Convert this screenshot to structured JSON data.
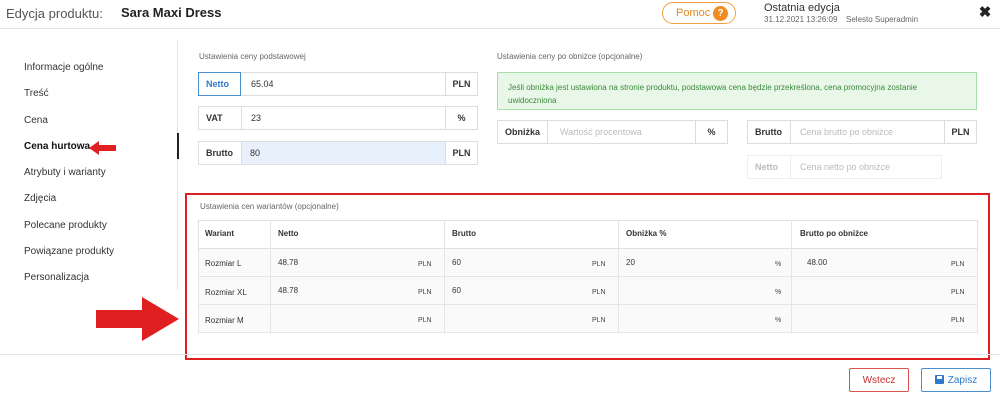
{
  "header": {
    "title_prefix": "Edycja produktu:",
    "product_name": "Sara Maxi Dress",
    "help_label": "Pomoc",
    "help_icon": "?",
    "last_edit_label": "Ostatnia edycja",
    "last_edit_date": "31.12.2021   13:26:09",
    "last_edit_user": "Selesto Superadmin",
    "close_icon": "✖"
  },
  "sidebar": {
    "items": [
      {
        "label": "Informacje ogólne"
      },
      {
        "label": "Treść"
      },
      {
        "label": "Cena"
      },
      {
        "label": "Cena hurtowa"
      },
      {
        "label": "Atrybuty i warianty"
      },
      {
        "label": "Zdjęcia"
      },
      {
        "label": "Polecane produkty"
      },
      {
        "label": "Powiązane produkty"
      },
      {
        "label": "Personalizacja"
      }
    ]
  },
  "base_price": {
    "section_label": "Ustawienia ceny podstawowej",
    "netto_label": "Netto",
    "netto_value": "65.04",
    "netto_unit": "PLN",
    "vat_label": "VAT",
    "vat_value": "23",
    "vat_unit": "%",
    "brutto_label": "Brutto",
    "brutto_value": "80",
    "brutto_unit": "PLN"
  },
  "discount_price": {
    "section_label": "Ustawienia ceny po obniżce (opcjonalne)",
    "info": "Jeśli obniżka jest ustawiona na stronie produktu, podstawowa cena będzie przekreślona, cena promocyjna zostanie uwidoczniona",
    "discount_label": "Obniżka",
    "discount_placeholder": "Wartość procentowa",
    "discount_unit": "%",
    "brutto_label": "Brutto",
    "brutto_placeholder": "Cena brutto po obniżce",
    "brutto_unit": "PLN",
    "netto_label": "Netto",
    "netto_placeholder": "Cena netto po obniżce"
  },
  "variants": {
    "section_label": "Ustawienia cen wariantów (opcjonalne)",
    "columns": [
      "Wariant",
      "Netto",
      "Brutto",
      "Obniżka %",
      "Brutto po obniżce"
    ],
    "rows": [
      {
        "name": "Rozmiar L",
        "netto": "48.78",
        "netto_unit": "PLN",
        "brutto": "60",
        "brutto_unit": "PLN",
        "discount": "20",
        "discount_unit": "%",
        "brutto_after": "48.00",
        "brutto_after_unit": "PLN"
      },
      {
        "name": "Rozmiar XL",
        "netto": "48.78",
        "netto_unit": "PLN",
        "brutto": "60",
        "brutto_unit": "PLN",
        "discount": "",
        "discount_unit": "%",
        "brutto_after": "",
        "brutto_after_unit": "PLN"
      },
      {
        "name": "Rozmiar M",
        "netto": "",
        "netto_unit": "PLN",
        "brutto": "",
        "brutto_unit": "PLN",
        "discount": "",
        "discount_unit": "%",
        "brutto_after": "",
        "brutto_after_unit": "PLN"
      }
    ]
  },
  "footer": {
    "back_label": "Wstecz",
    "save_label": "Zapisz"
  },
  "colors": {
    "accent": "#2e7ac9",
    "highlight_red": "#e02020",
    "help_orange": "#f08c1e",
    "info_green": "#3c8a3c"
  }
}
